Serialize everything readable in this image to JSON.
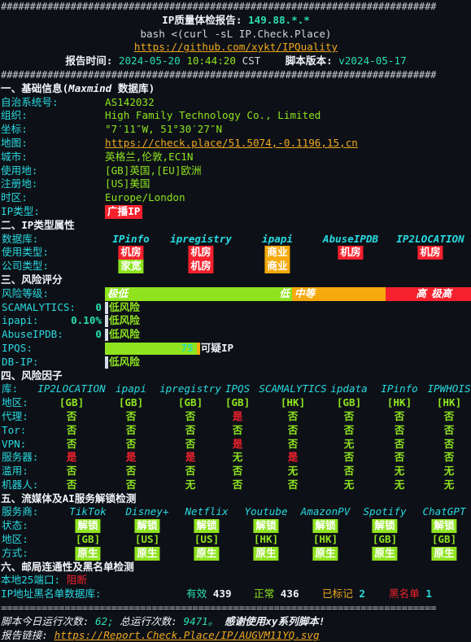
{
  "header": {
    "rule": "###########################################################################",
    "title_label": "IP质量体检报告:",
    "ip": "149.88.*.*",
    "command": "bash <(curl -sL IP.Check.Place)",
    "repo_url": "https://github.com/xykt/IPQuality",
    "time_label": "报告时间:",
    "date": "2024-05-20",
    "time": "10:44:20",
    "tz": "CST",
    "version_label": "脚本版本:",
    "version": "v2024-05-17"
  },
  "section1": {
    "title": "一、基础信息(",
    "title_db": "Maxmind",
    "title_tail": " 数据库)",
    "rows": [
      {
        "label": "自治系统号:",
        "value": "AS142032",
        "style": "green"
      },
      {
        "label": "组织:",
        "value": "High Family Technology Co., Limited",
        "style": "green"
      },
      {
        "label": "坐标:",
        "value": "°7′11″W, 51°30′27″N",
        "style": "green"
      },
      {
        "label": "地图:",
        "value": "https://check.place/51.5074,-0.1196,15,cn",
        "style": "link"
      },
      {
        "label": "城市:",
        "value": "英格兰,伦敦,EC1N",
        "style": "green"
      },
      {
        "label": "使用地:",
        "value": "[GB]英国,[EU]欧洲",
        "style": "green"
      },
      {
        "label": "注册地:",
        "value": "[US]美国",
        "style": "green"
      },
      {
        "label": "时区:",
        "value": "Europe/London",
        "style": "green"
      },
      {
        "label": "IP类型:",
        "value": "广播IP",
        "style": "tag-red"
      }
    ]
  },
  "section2": {
    "title": "二、IP类型属性",
    "db_label": "数据库:",
    "usage_label": "使用类型:",
    "company_label": "公司类型:",
    "columns": [
      {
        "name": "IPinfo",
        "usage": "机房",
        "usage_color": "red",
        "company": "家宽",
        "company_color": "green"
      },
      {
        "name": "ipregistry",
        "usage": "机房",
        "usage_color": "red",
        "company": "机房",
        "company_color": "red"
      },
      {
        "name": "ipapi",
        "usage": "商业",
        "usage_color": "orange",
        "company": "商业",
        "company_color": "orange"
      },
      {
        "name": "AbuseIPDB",
        "usage": "机房",
        "usage_color": "red",
        "company": "",
        "company_color": ""
      },
      {
        "name": "IP2LOCATION",
        "usage": "机房",
        "usage_color": "red",
        "company": "",
        "company_color": ""
      }
    ]
  },
  "section3": {
    "title": "三、风险评分",
    "level_label": "风险等级:",
    "levels": [
      {
        "name": "极低",
        "color": "#8fe31f"
      },
      {
        "name": "低",
        "color": "#8fe31f"
      },
      {
        "name": "中等",
        "color": "#f5a90c"
      },
      {
        "name": "高",
        "color": "#f5212d"
      },
      {
        "name": "极高",
        "color": "#f5212d"
      }
    ],
    "scores": [
      {
        "label": "SCAMALYTICS:",
        "value": "0",
        "bar_pct": 0,
        "verdict": "低风险",
        "verdict_color": "green",
        "bar_color": "#8fe31f"
      },
      {
        "label": "ipapi:",
        "value": "0.10%",
        "bar_pct": 0,
        "verdict": "低风险",
        "verdict_color": "green",
        "bar_color": "#8fe31f"
      },
      {
        "label": "AbuseIPDB:",
        "value": "0",
        "bar_pct": 0,
        "verdict": "低风险",
        "verdict_color": "green",
        "bar_color": "#8fe31f"
      },
      {
        "label": "IPQS:",
        "value": "75",
        "bar_pct": 25,
        "verdict": "可疑IP",
        "verdict_color": "white",
        "bar_color": "#8fe31f"
      },
      {
        "label": "DB-IP:",
        "value": "",
        "bar_pct": 0,
        "verdict": "低风险",
        "verdict_color": "green",
        "bar_color": "#8fe31f"
      }
    ]
  },
  "section4": {
    "title": "四、风险因子",
    "db_label": "库:",
    "row_labels": [
      "地区:",
      "代理:",
      "Tor:",
      "VPN:",
      "服务器:",
      "滥用:",
      "机器人:"
    ],
    "columns": [
      {
        "name": "IP2LOCATION",
        "values": [
          "[GB]",
          "否",
          "否",
          "否",
          "是",
          "否",
          "否"
        ],
        "colors": [
          "green",
          "green",
          "green",
          "green",
          "red",
          "green",
          "green"
        ]
      },
      {
        "name": "ipapi",
        "values": [
          "[GB]",
          "否",
          "否",
          "否",
          "是",
          "否",
          "否"
        ],
        "colors": [
          "green",
          "green",
          "green",
          "green",
          "red",
          "green",
          "green"
        ]
      },
      {
        "name": "ipregistry",
        "values": [
          "[GB]",
          "否",
          "否",
          "否",
          "是",
          "否",
          "无"
        ],
        "colors": [
          "green",
          "green",
          "green",
          "green",
          "red",
          "green",
          "green"
        ]
      },
      {
        "name": "IPQS",
        "values": [
          "[GB]",
          "是",
          "否",
          "是",
          "无",
          "否",
          "否"
        ],
        "colors": [
          "green",
          "red",
          "green",
          "red",
          "green",
          "green",
          "green"
        ]
      },
      {
        "name": "SCAMALYTICS",
        "values": [
          "[HK]",
          "否",
          "否",
          "否",
          "是",
          "无",
          "否"
        ],
        "colors": [
          "green",
          "green",
          "green",
          "green",
          "red",
          "green",
          "green"
        ]
      },
      {
        "name": "ipdata",
        "values": [
          "[GB]",
          "否",
          "否",
          "无",
          "否",
          "否",
          "无"
        ],
        "colors": [
          "green",
          "green",
          "green",
          "green",
          "green",
          "green",
          "green"
        ]
      },
      {
        "name": "IPinfo",
        "values": [
          "[HK]",
          "否",
          "否",
          "否",
          "否",
          "无",
          "无"
        ],
        "colors": [
          "green",
          "green",
          "green",
          "green",
          "green",
          "green",
          "green"
        ]
      },
      {
        "name": "IPWHOIS",
        "values": [
          "[HK]",
          "否",
          "否",
          "否",
          "否",
          "无",
          "无"
        ],
        "colors": [
          "green",
          "green",
          "green",
          "green",
          "green",
          "green",
          "green"
        ]
      }
    ]
  },
  "section5": {
    "title": "五、流媒体及AI服务解锁检测",
    "provider_label": "服务商:",
    "status_label": "状态:",
    "region_label": "地区:",
    "method_label": "方式:",
    "columns": [
      {
        "name": "TikTok",
        "status": "解锁",
        "region": "[GB]",
        "method": "原生"
      },
      {
        "name": "Disney+",
        "status": "解锁",
        "region": "[US]",
        "method": "原生"
      },
      {
        "name": "Netflix",
        "status": "解锁",
        "region": "[US]",
        "method": "原生"
      },
      {
        "name": "Youtube",
        "status": "解锁",
        "region": "[HK]",
        "method": "原生"
      },
      {
        "name": "AmazonPV",
        "status": "解锁",
        "region": "[HK]",
        "method": "原生"
      },
      {
        "name": "Spotify",
        "status": "解锁",
        "region": "[GB]",
        "method": "原生"
      },
      {
        "name": "ChatGPT",
        "status": "解锁",
        "region": "[GB]",
        "method": "原生"
      }
    ]
  },
  "section6": {
    "title": "六、邮局连通性及黑名单检测",
    "port_label": "本地25端口:",
    "port_value": "阻断",
    "blacklist_label": "IP地址黑名单数据库:",
    "stats": [
      {
        "name": "有效",
        "value": "439",
        "name_color": "teal",
        "value_color": "white"
      },
      {
        "name": "正常",
        "value": "436",
        "name_color": "green",
        "value_color": "white"
      },
      {
        "name": "已标记",
        "value": "2",
        "name_color": "orange",
        "value_color": "cyan"
      },
      {
        "name": "黑名单",
        "value": "1",
        "name_color": "red",
        "value_color": "cyan"
      }
    ]
  },
  "footer": {
    "rule": "===========================================================================",
    "today_label": "脚本今日运行次数:",
    "today_count": "62;",
    "total_label": "总运行次数:",
    "total_count": "9471。",
    "thanks": "感谢使用xy系列脚本!",
    "report_label": "报告链接:",
    "report_url": "https://Report.Check.Place/IP/AUGVM11YQ.svg"
  }
}
